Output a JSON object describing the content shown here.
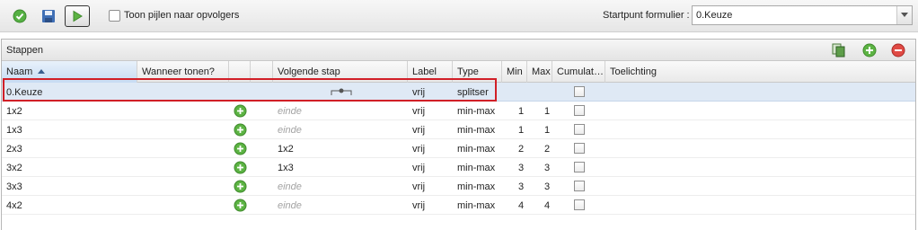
{
  "toolbar": {
    "buttons": [
      {
        "icon": "check-circle-icon"
      },
      {
        "icon": "save-icon"
      },
      {
        "icon": "play-icon"
      }
    ],
    "show_arrows_label": "Toon pijlen naar opvolgers",
    "startpoint_label": "Startpunt formulier :",
    "startpoint_value": "0.Keuze"
  },
  "panel": {
    "title": "Stappen",
    "actions": [
      {
        "icon": "copy-icon"
      },
      {
        "icon": "add-icon"
      },
      {
        "icon": "remove-icon"
      }
    ]
  },
  "columns": {
    "naam": "Naam",
    "wanneer": "Wanneer tonen?",
    "volgende": "Volgende stap",
    "label": "Label",
    "type": "Type",
    "min": "Min",
    "max": "Max",
    "cumulat": "Cumulat…",
    "toelichting": "Toelichting"
  },
  "rows": [
    {
      "naam": "0.Keuze",
      "volgende": "",
      "label": "vrij",
      "type": "splitser",
      "min": "",
      "max": "",
      "selected": true
    },
    {
      "naam": "1x2",
      "volgende": "einde",
      "label": "vrij",
      "type": "min-max",
      "min": "1",
      "max": "1"
    },
    {
      "naam": "1x3",
      "volgende": "einde",
      "label": "vrij",
      "type": "min-max",
      "min": "1",
      "max": "1"
    },
    {
      "naam": "2x3",
      "volgende": "1x2",
      "label": "vrij",
      "type": "min-max",
      "min": "2",
      "max": "2"
    },
    {
      "naam": "3x2",
      "volgende": "1x3",
      "label": "vrij",
      "type": "min-max",
      "min": "3",
      "max": "3"
    },
    {
      "naam": "3x3",
      "volgende": "einde",
      "label": "vrij",
      "type": "min-max",
      "min": "3",
      "max": "3"
    },
    {
      "naam": "4x2",
      "volgende": "einde",
      "label": "vrij",
      "type": "min-max",
      "min": "4",
      "max": "4"
    }
  ],
  "colors": {
    "accent_red": "#d11f27",
    "selected_row": "#dfe9f5",
    "green": "#4caf3c"
  }
}
